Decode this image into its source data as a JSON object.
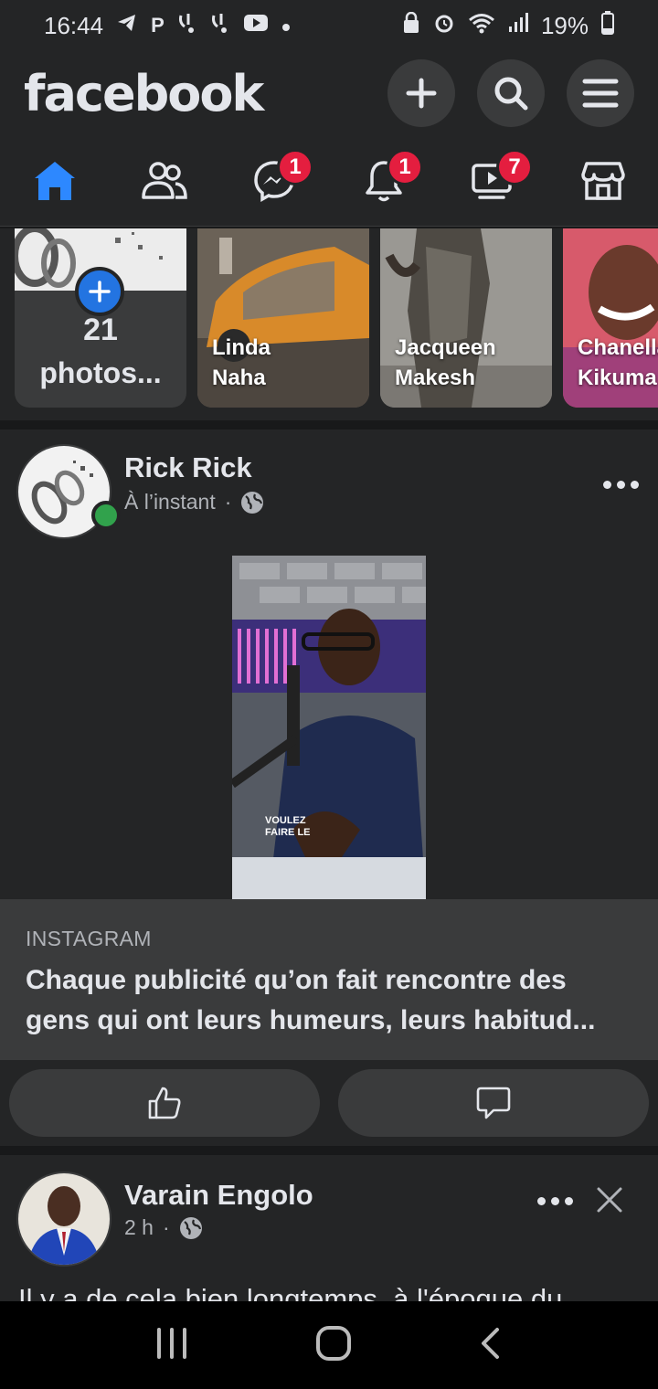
{
  "status_bar": {
    "time": "16:44",
    "left_icons": [
      "telegram-icon",
      "p-icon",
      "notification-icon",
      "notification-icon",
      "youtube-icon",
      "dot"
    ],
    "battery": "19%",
    "right_icons": [
      "lock-icon",
      "alarm-icon",
      "wifi-icon",
      "signal-icon",
      "battery-icon"
    ]
  },
  "header": {
    "logo": "facebook",
    "buttons": [
      "add-icon",
      "search-icon",
      "menu-icon"
    ]
  },
  "nav": {
    "active": "home",
    "items": [
      {
        "name": "home",
        "icon": "home-icon",
        "badge": ""
      },
      {
        "name": "friends",
        "icon": "friends-icon",
        "badge": ""
      },
      {
        "name": "messenger",
        "icon": "messenger-icon",
        "badge": "1"
      },
      {
        "name": "notifications",
        "icon": "bell-icon",
        "badge": "1"
      },
      {
        "name": "watch",
        "icon": "video-icon",
        "badge": "7"
      },
      {
        "name": "marketplace",
        "icon": "store-icon",
        "badge": ""
      }
    ]
  },
  "stories": {
    "create": {
      "count": "21",
      "label": "photos..."
    },
    "items": [
      {
        "name_line1": "Linda",
        "name_line2": "Naha"
      },
      {
        "name_line1": "Jacqueen",
        "name_line2": "Makesh"
      },
      {
        "name_line1": "Chanella",
        "name_line2": "Kikuma"
      }
    ]
  },
  "post1": {
    "author": "Rick Rick",
    "time": "À l’instant",
    "separator": "·",
    "media_caption": "VOULEZ FAIRE LE",
    "link_source": "INSTAGRAM",
    "link_title": "Chaque publicité qu’on fait rencontre des gens qui ont leurs humeurs, leurs habitud..."
  },
  "post2": {
    "author": "Varain Engolo",
    "time": "2 h",
    "separator": "·",
    "text": "Il y a de cela bien longtemps, à l'époque du"
  },
  "colors": {
    "accent": "#2374e1",
    "badge": "#e41e3f",
    "online": "#31a24c",
    "surface": "#242526",
    "background": "#18191a"
  }
}
